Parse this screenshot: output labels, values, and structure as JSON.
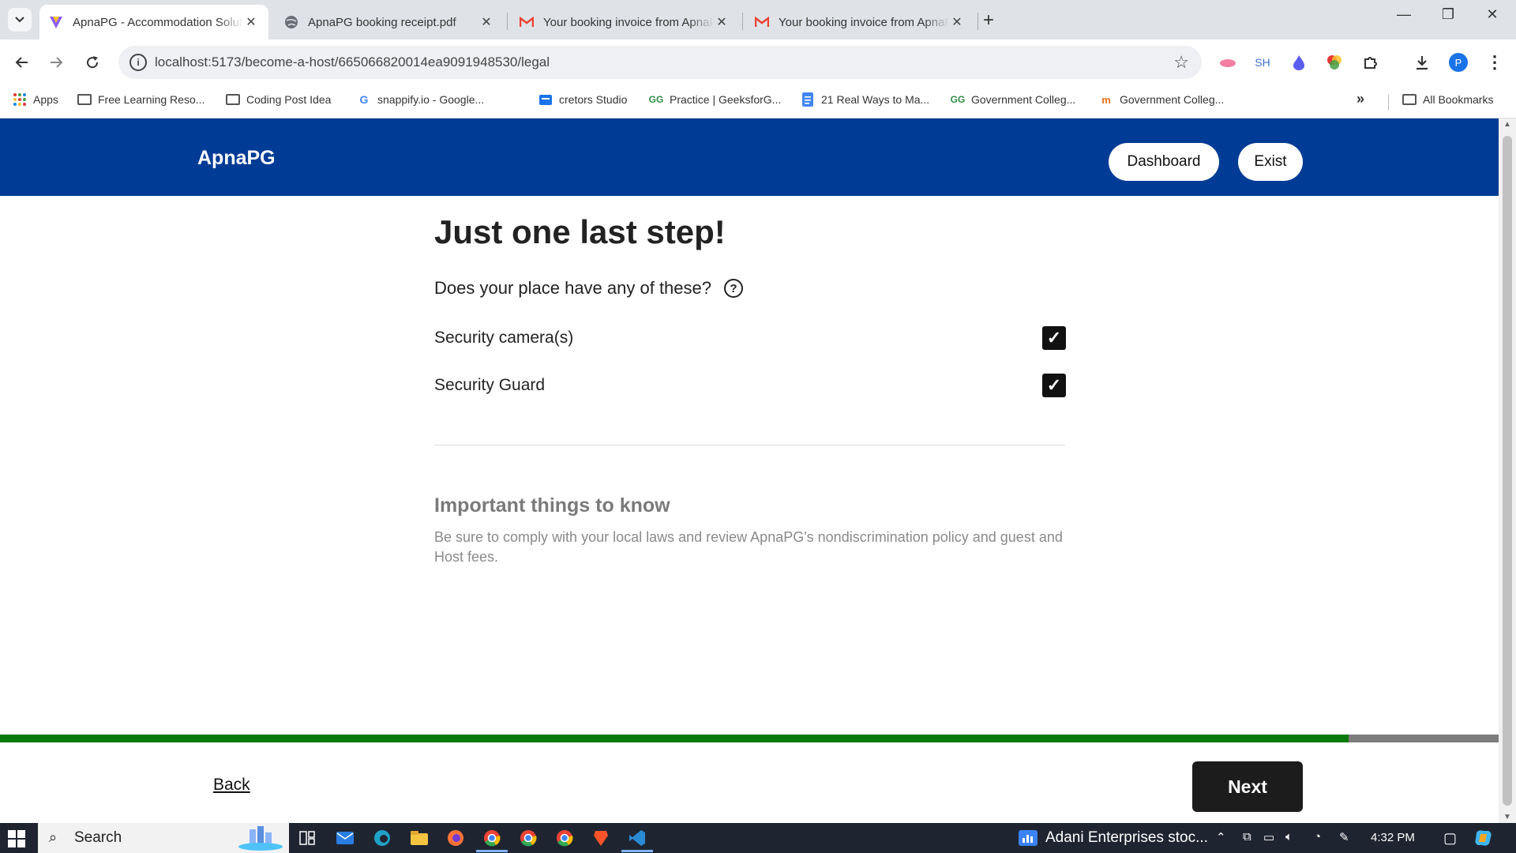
{
  "browser": {
    "tabs": [
      {
        "title": "ApnaPG - Accommodation Solutions",
        "active": true
      },
      {
        "title": "ApnaPG booking receipt.pdf",
        "active": false
      },
      {
        "title": "Your booking invoice from ApnaPG",
        "active": false
      },
      {
        "title": "Your booking invoice from ApnaPG",
        "active": false
      }
    ],
    "url": "localhost:5173/become-a-host/665066820014ea9091948530/legal",
    "extensions": {
      "sh": "SH"
    },
    "profile_initial": "P",
    "bookmarks": [
      {
        "label": "Apps",
        "icon": "apps-grid-icon"
      },
      {
        "label": "Free Learning Reso...",
        "icon": "folder-icon"
      },
      {
        "label": "Coding Post Idea",
        "icon": "folder-icon"
      },
      {
        "label": "snappify.io - Google...",
        "icon": "google-icon"
      },
      {
        "label": "cretors Studio",
        "icon": "studio-icon"
      },
      {
        "label": "Practice | GeeksforG...",
        "icon": "gfg-icon"
      },
      {
        "label": "21 Real Ways to Ma...",
        "icon": "doc-icon"
      },
      {
        "label": "Government Colleg...",
        "icon": "gfg-icon"
      },
      {
        "label": "Government Colleg...",
        "icon": "college-icon"
      }
    ],
    "all_bookmarks": "All Bookmarks"
  },
  "header": {
    "brand": "ApnaPG",
    "dashboard_label": "Dashboard",
    "exit_label": "Exist",
    "bg_color": "#003b95"
  },
  "main": {
    "title": "Just one last step!",
    "question": "Does your place have any of these?",
    "options": [
      {
        "label": "Security camera(s)",
        "checked": true
      },
      {
        "label": "Security Guard",
        "checked": true
      }
    ],
    "info_title": "Important things to know",
    "info_text": "Be sure to comply with your local laws and review ApnaPG's nondiscrimination policy and guest and Host fees."
  },
  "footer": {
    "progress_percent": 90,
    "progress_color": "#077a0a",
    "back_label": "Back",
    "next_label": "Next"
  },
  "taskbar": {
    "search_label": "Search",
    "news_text": "Adani Enterprises stoc...",
    "time": "4:32 PM"
  }
}
